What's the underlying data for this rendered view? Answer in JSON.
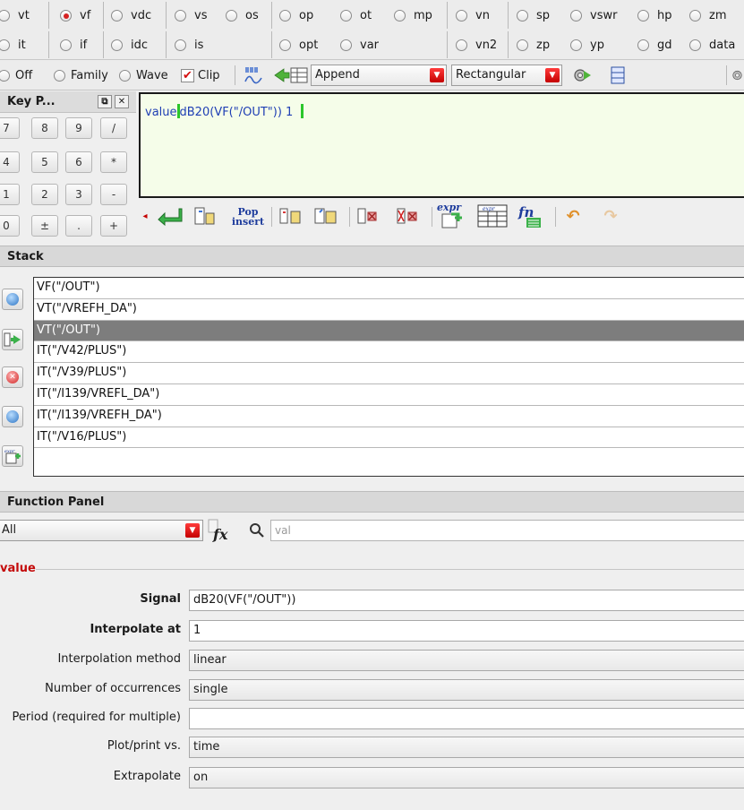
{
  "analysis_radios_row1": [
    {
      "label": "vt",
      "selected": false
    },
    {
      "label": "vf",
      "selected": true
    },
    {
      "label": "vdc",
      "selected": false
    },
    {
      "label": "vs",
      "selected": false
    },
    {
      "label": "os",
      "selected": false
    },
    {
      "label": "op",
      "selected": false
    },
    {
      "label": "ot",
      "selected": false
    },
    {
      "label": "mp",
      "selected": false
    },
    {
      "label": "vn",
      "selected": false
    },
    {
      "label": "sp",
      "selected": false
    },
    {
      "label": "vswr",
      "selected": false
    },
    {
      "label": "hp",
      "selected": false
    },
    {
      "label": "zm",
      "selected": false
    }
  ],
  "analysis_radios_row2": [
    {
      "label": "it",
      "selected": false
    },
    {
      "label": "if",
      "selected": false
    },
    {
      "label": "idc",
      "selected": false
    },
    {
      "label": "is",
      "selected": false
    },
    {
      "label": "opt",
      "selected": false
    },
    {
      "label": "var",
      "selected": false
    },
    {
      "label": "vn2",
      "selected": false
    },
    {
      "label": "zp",
      "selected": false
    },
    {
      "label": "yp",
      "selected": false
    },
    {
      "label": "gd",
      "selected": false
    },
    {
      "label": "data",
      "selected": false
    }
  ],
  "toolbar": {
    "off_label": "Off",
    "family_label": "Family",
    "wave_label": "Wave",
    "clip_label": "Clip",
    "clip_checked": true,
    "append_mode": "Append",
    "plot_type": "Rectangular"
  },
  "key_panel": {
    "title": "Key P...",
    "keys": [
      "7",
      "8",
      "9",
      "/",
      "4",
      "5",
      "6",
      "*",
      "1",
      "2",
      "3",
      "-",
      "0",
      "±",
      ".",
      "+"
    ]
  },
  "expression": {
    "func": "value",
    "arg": "dB20(VF(\"/OUT\")) 1  "
  },
  "expr_toolbar": {
    "pop_insert_line1": "Pop",
    "pop_insert_line2": "insert",
    "expr_label": "expr"
  },
  "stack": {
    "title": "Stack",
    "items": [
      "VF(\"/OUT\")",
      "VT(\"/VREFH_DA\")",
      "VT(\"/OUT\")",
      "IT(\"/V42/PLUS\")",
      "IT(\"/V39/PLUS\")",
      "IT(\"/I139/VREFL_DA\")",
      "IT(\"/I139/VREFH_DA\")",
      "IT(\"/V16/PLUS\")"
    ],
    "selected_index": 2
  },
  "function_panel": {
    "title": "Function Panel",
    "category": "All",
    "search_value": "val",
    "function_name": "value",
    "fields": [
      {
        "label": "Signal",
        "value": "dB20(VF(\"/OUT\"))",
        "bold": true,
        "kind": "text"
      },
      {
        "label": "Interpolate at",
        "value": "1",
        "bold": true,
        "kind": "text"
      },
      {
        "label": "Interpolation method",
        "value": "linear",
        "bold": false,
        "kind": "combo"
      },
      {
        "label": "Number of occurrences",
        "value": "single",
        "bold": false,
        "kind": "combo"
      },
      {
        "label": "Period (required for multiple)",
        "value": "",
        "bold": false,
        "kind": "text"
      },
      {
        "label": "Plot/print vs.",
        "value": "time",
        "bold": false,
        "kind": "combo"
      },
      {
        "label": "Extrapolate",
        "value": "on",
        "bold": false,
        "kind": "combo"
      }
    ]
  },
  "colors": {
    "accent_red": "#d62222",
    "expr_bg": "#f5fde9",
    "expr_text": "#1f3fb4",
    "cursor": "#2bc62b",
    "selected_row": "#7d7d7d"
  }
}
